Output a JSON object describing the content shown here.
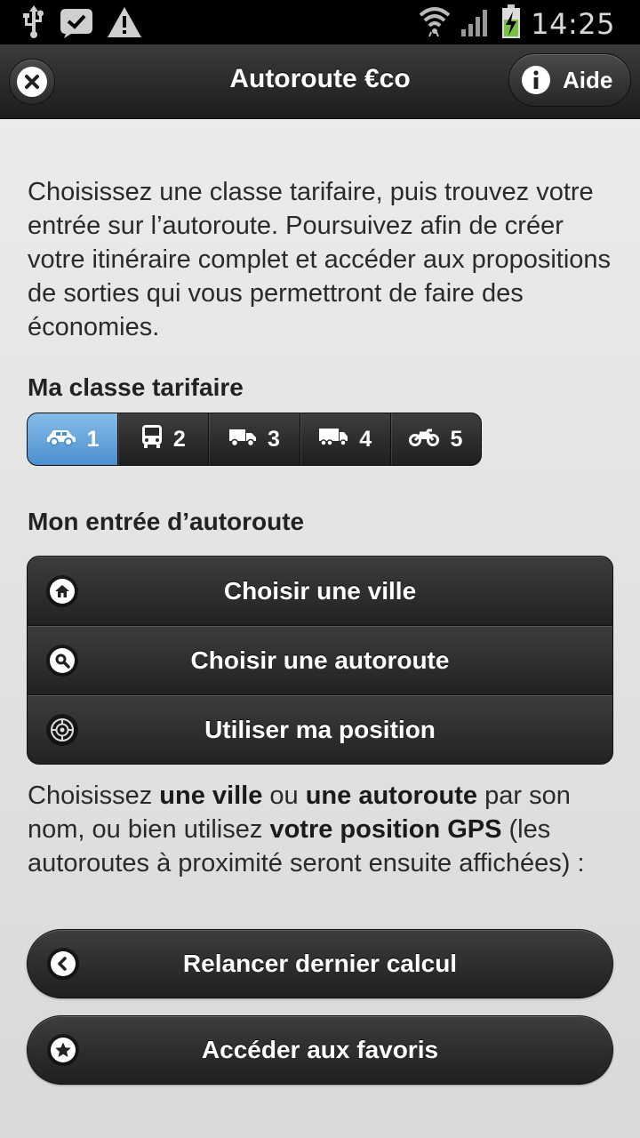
{
  "status_bar": {
    "time": "14:25",
    "icons": [
      "usb-icon",
      "notification-icon",
      "warning-icon",
      "wifi-icon",
      "signal-icon",
      "battery-icon"
    ]
  },
  "header": {
    "title": "Autoroute €co",
    "close_icon": "close-icon",
    "help_label": "Aide",
    "help_icon": "info-icon"
  },
  "intro": {
    "text": "Choisissez une classe tarifaire, puis trouvez votre entrée sur l’autoroute. Poursuivez afin de créer votre itinéraire complet et accéder aux propositions de sorties qui vous permettront de faire des économies."
  },
  "tariff": {
    "title": "Ma classe tarifaire",
    "selected": "1",
    "classes": [
      {
        "label": "1",
        "icon": "car-icon"
      },
      {
        "label": "2",
        "icon": "bus-icon"
      },
      {
        "label": "3",
        "icon": "small-truck-icon"
      },
      {
        "label": "4",
        "icon": "truck-icon"
      },
      {
        "label": "5",
        "icon": "motorcycle-icon"
      }
    ]
  },
  "entry": {
    "title": "Mon entrée d’autoroute",
    "buttons": [
      {
        "label": "Choisir une ville",
        "icon": "home-icon"
      },
      {
        "label": "Choisir une autoroute",
        "icon": "search-icon"
      },
      {
        "label": "Utiliser ma position",
        "icon": "gps-icon"
      }
    ]
  },
  "help_text": {
    "p1": "Choisissez ",
    "b1": "une ville",
    "p2": " ou ",
    "b2": "une autoroute",
    "p3": " par son nom, ou bien utilisez ",
    "b3": "votre position GPS",
    "p4": " (les autoroutes à proximité seront ensuite affichées) :"
  },
  "actions": {
    "relaunch_label": "Relancer dernier calcul",
    "relaunch_icon": "back-arrow-icon",
    "favorites_label": "Accéder aux favoris",
    "favorites_icon": "star-icon"
  },
  "colors": {
    "accent": "#5b9ee0",
    "header_bg": "#262626",
    "page_bg": "#e2e2e2"
  }
}
